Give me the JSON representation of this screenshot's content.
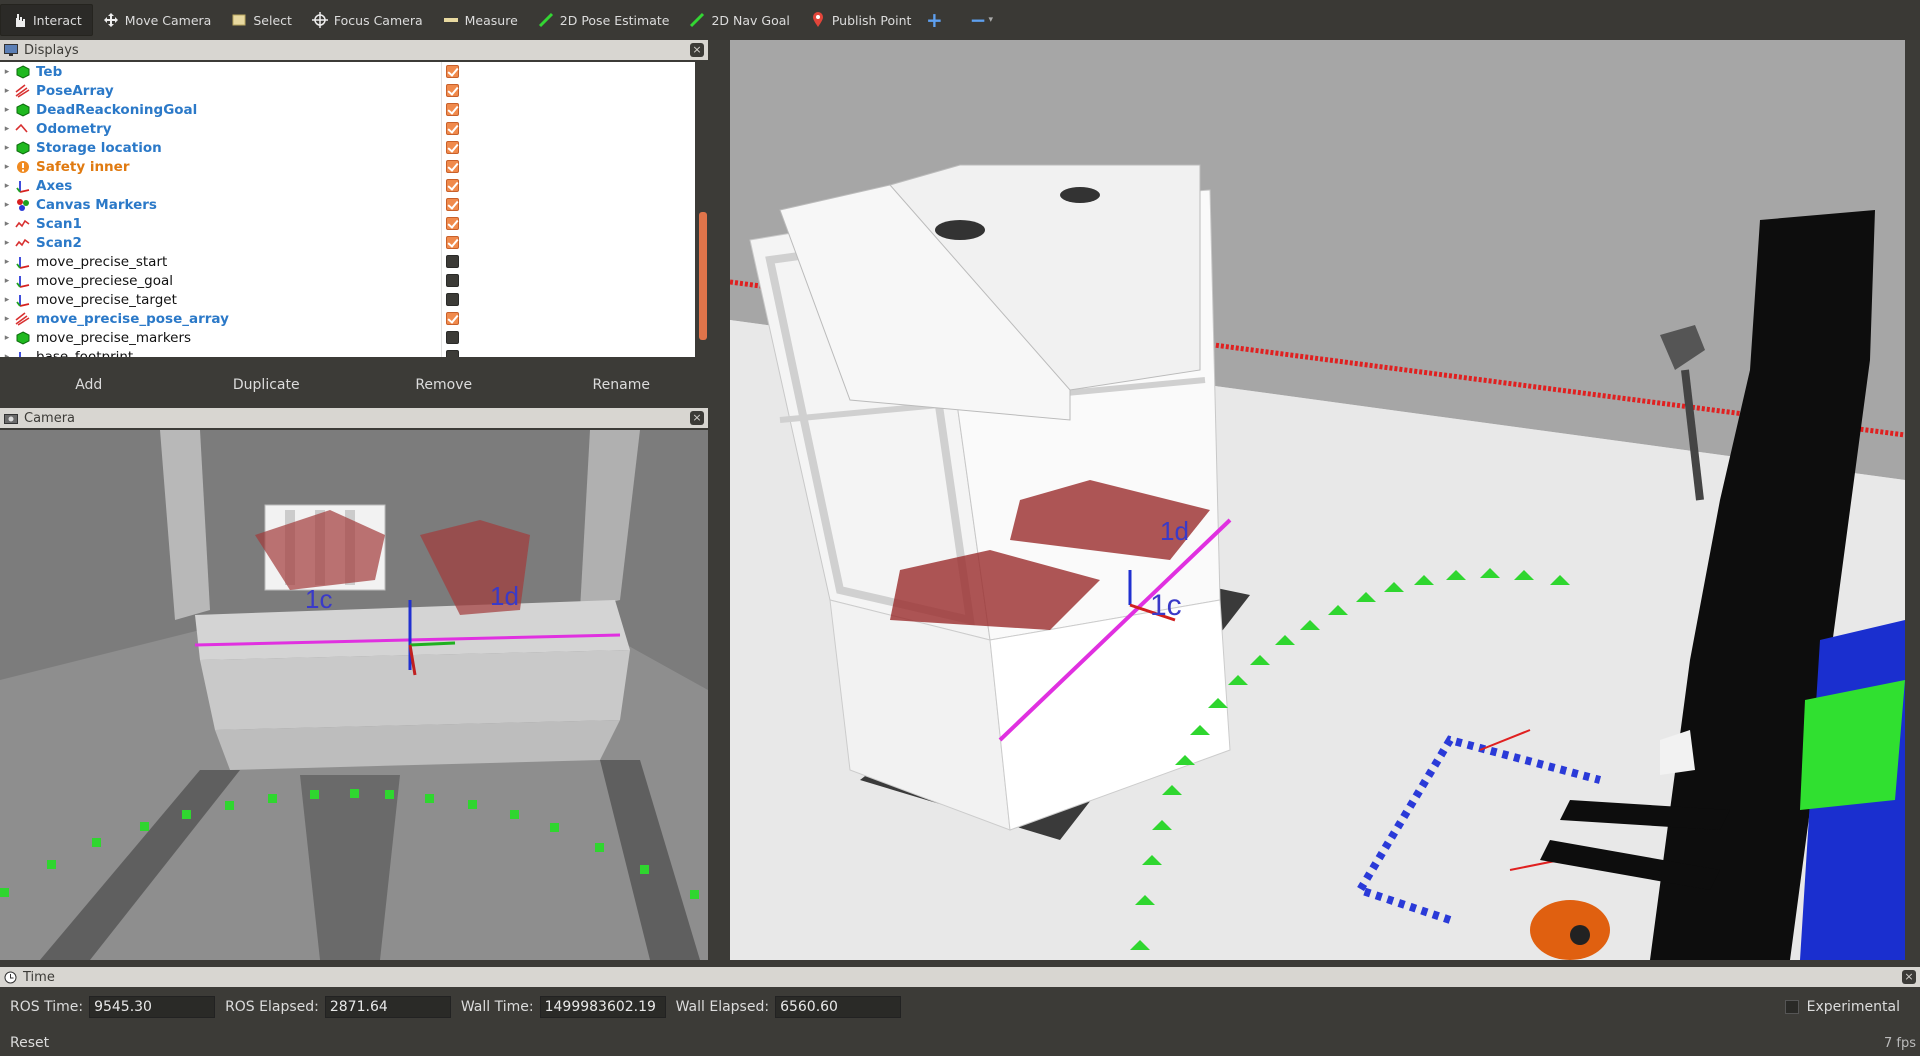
{
  "toolbar": {
    "tools": [
      {
        "label": "Interact",
        "icon": "hand-cursor-icon"
      },
      {
        "label": "Move Camera",
        "icon": "move-arrows-icon"
      },
      {
        "label": "Select",
        "icon": "select-box-icon"
      },
      {
        "label": "Focus Camera",
        "icon": "crosshair-icon"
      },
      {
        "label": "Measure",
        "icon": "ruler-icon"
      },
      {
        "label": "2D Pose Estimate",
        "icon": "green-arrow-icon"
      },
      {
        "label": "2D Nav Goal",
        "icon": "green-arrow-icon"
      },
      {
        "label": "Publish Point",
        "icon": "map-pin-icon"
      }
    ],
    "add": "+",
    "remove": "−"
  },
  "displays": {
    "title": "Displays",
    "close": "×",
    "items": [
      {
        "label": "Teb",
        "style": "blue",
        "icon": "green-cube-icon",
        "checked": true
      },
      {
        "label": "PoseArray",
        "style": "blue",
        "icon": "pose-array-icon",
        "checked": true
      },
      {
        "label": "DeadReackoningGoal",
        "style": "blue",
        "icon": "green-cube-icon",
        "checked": true
      },
      {
        "label": "Odometry",
        "style": "blue",
        "icon": "odometry-icon",
        "checked": true
      },
      {
        "label": "Storage location",
        "style": "blue",
        "icon": "green-cube-icon",
        "checked": true
      },
      {
        "label": "Safety inner",
        "style": "orange",
        "icon": "warning-icon",
        "checked": true
      },
      {
        "label": "Axes",
        "style": "blue",
        "icon": "axes-icon",
        "checked": true
      },
      {
        "label": "Canvas Markers",
        "style": "blue",
        "icon": "markers-icon",
        "checked": true
      },
      {
        "label": "Scan1",
        "style": "blue",
        "icon": "laser-scan-icon",
        "checked": true
      },
      {
        "label": "Scan2",
        "style": "blue",
        "icon": "laser-scan-icon",
        "checked": true
      },
      {
        "label": "move_precise_start",
        "style": "plain",
        "icon": "axes-icon",
        "checked": false
      },
      {
        "label": "move_preciese_goal",
        "style": "plain",
        "icon": "axes-icon",
        "checked": false
      },
      {
        "label": "move_precise_target",
        "style": "plain",
        "icon": "axes-icon",
        "checked": false
      },
      {
        "label": "move_precise_pose_array",
        "style": "blue-underline",
        "icon": "pose-array-icon",
        "checked": true
      },
      {
        "label": "move_precise_markers",
        "style": "plain",
        "icon": "green-cube-icon",
        "checked": false
      },
      {
        "label": "base_footprint",
        "style": "plain",
        "icon": "axes-icon",
        "checked": false
      }
    ],
    "buttons": [
      "Add",
      "Duplicate",
      "Remove",
      "Rename"
    ]
  },
  "camera": {
    "title": "Camera",
    "close": "×",
    "labels": [
      "1c",
      "1d"
    ]
  },
  "scene": {
    "labels": [
      "1d",
      "1c"
    ]
  },
  "time": {
    "title": "Time",
    "close": "×",
    "ros_time_label": "ROS Time:",
    "ros_time": "9545.30",
    "ros_elapsed_label": "ROS Elapsed:",
    "ros_elapsed": "2871.64",
    "wall_time_label": "Wall Time:",
    "wall_time": "1499983602.19",
    "wall_elapsed_label": "Wall Elapsed:",
    "wall_elapsed": "6560.60",
    "experimental_label": "Experimental",
    "experimental_checked": false
  },
  "footer": {
    "reset": "Reset",
    "fps": "7 fps"
  }
}
